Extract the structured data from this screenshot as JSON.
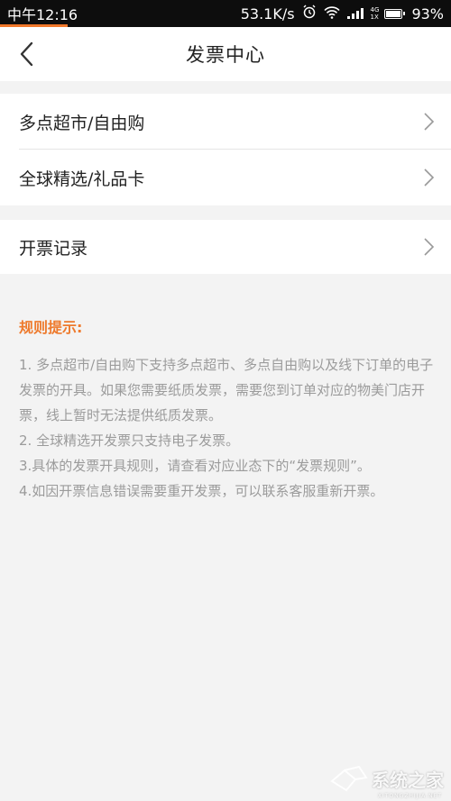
{
  "status_bar": {
    "time": "中午12:16",
    "network_speed": "53.1K/s",
    "network_type": "4G",
    "network_sub": "1X",
    "battery": "93%"
  },
  "nav": {
    "title": "发票中心"
  },
  "menu": {
    "items": [
      {
        "label": "多点超市/自由购"
      },
      {
        "label": "全球精选/礼品卡"
      }
    ],
    "records": {
      "label": "开票记录"
    }
  },
  "rules": {
    "heading": "规则提示:",
    "items": [
      "1. 多点超市/自由购下支持多点超市、多点自由购以及线下订单的电子发票的开具。如果您需要纸质发票，需要您到订单对应的物美门店开票，线上暂时无法提供纸质发票。",
      "2. 全球精选开发票只支持电子发票。",
      "3.具体的发票开具规则，请查看对应业态下的“发票规则”。",
      "4.如因开票信息错误需要重开发票，可以联系客服重新开票。"
    ]
  },
  "watermark": {
    "text": "系统之家",
    "sub": "XITONGZHIJIA.NET"
  },
  "colors": {
    "accent": "#ee7a2c",
    "status_bg": "#0d0d0d",
    "page_bg": "#f3f3f3"
  }
}
